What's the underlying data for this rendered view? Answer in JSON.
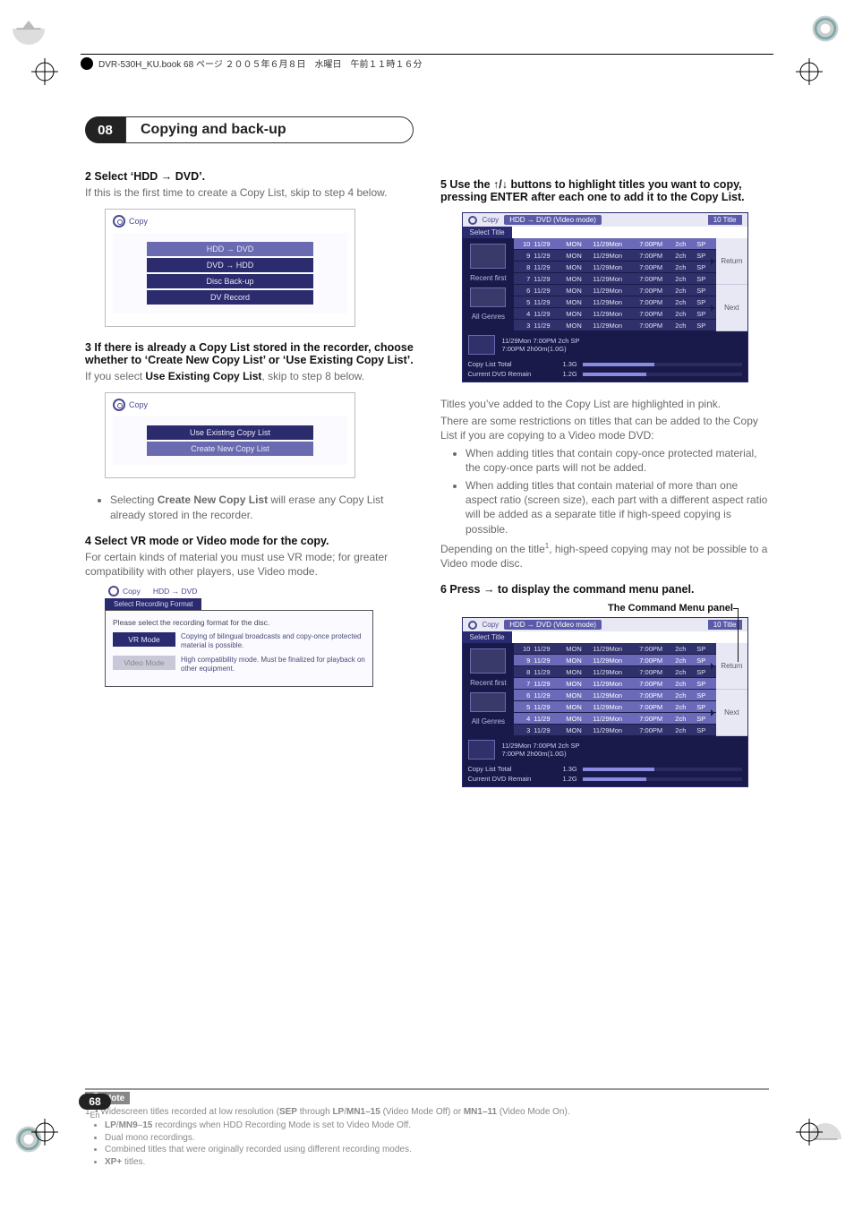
{
  "header_line": "DVR-530H_KU.book  68 ページ  ２００５年６月８日　水曜日　午前１１時１６分",
  "chapter_num": "08",
  "chapter_title": "Copying and back-up",
  "page_num": "68",
  "page_lang": "En",
  "left": {
    "step2_head": "2    Select ‘HDD → DVD’.",
    "step2_text": "If this is the first time to create a Copy List, skip to step 4 below.",
    "ui1_title": "Copy",
    "ui1_items": [
      "HDD → DVD",
      "DVD → HDD",
      "Disc Back-up",
      "DV Record"
    ],
    "step3_head": "3    If there is already a Copy List stored in the recorder, choose whether to ‘Create New Copy List’ or ‘Use Existing Copy List’.",
    "step3_text_pre": "If you select ",
    "step3_bold": "Use Existing Copy List",
    "step3_text_post": ", skip to step 8 below.",
    "ui2_items": [
      "Use Existing Copy List",
      "Create New Copy List"
    ],
    "bullet3_pre": "Selecting ",
    "bullet3_bold": "Create New Copy List",
    "bullet3_post": " will erase any Copy List already stored in the recorder.",
    "step4_head": "4    Select VR mode or Video mode for the copy.",
    "step4_text": "For certain kinds of material you must use VR mode; for greater compatibility with other players, use Video mode.",
    "vr_head_copy": "Copy",
    "vr_head_sub": "HDD → DVD",
    "vr_tab": "Select Recording Format",
    "vr_intro": "Please select the recording format for the disc.",
    "vr_btn1": "VR Mode",
    "vr_desc1": "Copying of bilingual broadcasts and copy-once protected material is possible.",
    "vr_btn2": "Video Mode",
    "vr_desc2": "High compatibility mode. Must be finalized for playback on other equipment."
  },
  "right": {
    "step5_head": "5    Use the ↑/↓ buttons to highlight titles you want to copy, pressing ENTER after each one to add it to the Copy List.",
    "copypanel": {
      "top_left": "Copy",
      "top_mode": "HDD → DVD  (Video mode)",
      "top_count": "10  Title",
      "tab": "Select Title",
      "left_labels": [
        "Recent first",
        "All Genres"
      ],
      "btn_return": "Return",
      "btn_next": "Next",
      "detail_line1": "11/29Mon   7:00PM   2ch   SP",
      "detail_line2": "7:00PM        2h00m(1.0G)",
      "tot_label": "Copy List Total",
      "tot_val": "1.3G",
      "rem_label": "Current DVD Remain",
      "rem_val": "1.2G",
      "rows": [
        {
          "n": "10",
          "d1": "11/29",
          "d2": "MON",
          "d3": "11/29Mon",
          "t": "7:00PM",
          "ch": "2ch",
          "sp": "SP",
          "sel": true
        },
        {
          "n": "9",
          "d1": "11/29",
          "d2": "MON",
          "d3": "11/29Mon",
          "t": "7:00PM",
          "ch": "2ch",
          "sp": "SP"
        },
        {
          "n": "8",
          "d1": "11/29",
          "d2": "MON",
          "d3": "11/29Mon",
          "t": "7:00PM",
          "ch": "2ch",
          "sp": "SP"
        },
        {
          "n": "7",
          "d1": "11/29",
          "d2": "MON",
          "d3": "11/29Mon",
          "t": "7:00PM",
          "ch": "2ch",
          "sp": "SP"
        },
        {
          "n": "6",
          "d1": "11/29",
          "d2": "MON",
          "d3": "11/29Mon",
          "t": "7:00PM",
          "ch": "2ch",
          "sp": "SP"
        },
        {
          "n": "5",
          "d1": "11/29",
          "d2": "MON",
          "d3": "11/29Mon",
          "t": "7:00PM",
          "ch": "2ch",
          "sp": "SP"
        },
        {
          "n": "4",
          "d1": "11/29",
          "d2": "MON",
          "d3": "11/29Mon",
          "t": "7:00PM",
          "ch": "2ch",
          "sp": "SP"
        },
        {
          "n": "3",
          "d1": "11/29",
          "d2": "MON",
          "d3": "11/29Mon",
          "t": "7:00PM",
          "ch": "2ch",
          "sp": "SP"
        }
      ]
    },
    "p_after5a": "Titles you’ve added to the Copy List are highlighted in pink.",
    "p_after5b": "There are some restrictions on titles that can be added to the Copy List if you are copying to a Video mode DVD:",
    "bul1": "When adding titles that contain copy-once protected material, the copy-once parts will not be added.",
    "bul2": "When adding titles that contain material of more than one aspect ratio (screen size), each part with a different aspect ratio will be added as a separate title if high-speed copying is possible.",
    "p_depend_pre": "Depending on the title",
    "p_depend_sup": "1",
    "p_depend_post": ", high-speed copying may not be possible to a Video mode disc.",
    "step6_head": "6    Press → to display the command menu panel.",
    "cmd_caption": "The Command Menu panel",
    "copypanel2_rows_sel": [
      4,
      5,
      6,
      7,
      9
    ]
  },
  "note": {
    "label": "Note",
    "line1_pre": "1. • Widescreen titles recorded at low resolution (",
    "line1_b1": "SEP",
    "line1_mid1": " through ",
    "line1_b2": "LP",
    "line1_mid2": "/",
    "line1_b3": "MN1–15",
    "line1_mid3": " (Video Mode Off) or ",
    "line1_b4": "MN1–11",
    "line1_post": " (Video Mode On).",
    "l2_b1": "LP",
    "l2_mid1": "/",
    "l2_b2": "MN9",
    "l2_mid2": "–",
    "l2_b3": "15",
    "l2_post": " recordings when HDD Recording Mode is set to Video Mode Off.",
    "l3": "Dual mono recordings.",
    "l4": "Combined titles that were originally recorded using different recording modes.",
    "l5_b": "XP+",
    "l5_post": " titles."
  }
}
